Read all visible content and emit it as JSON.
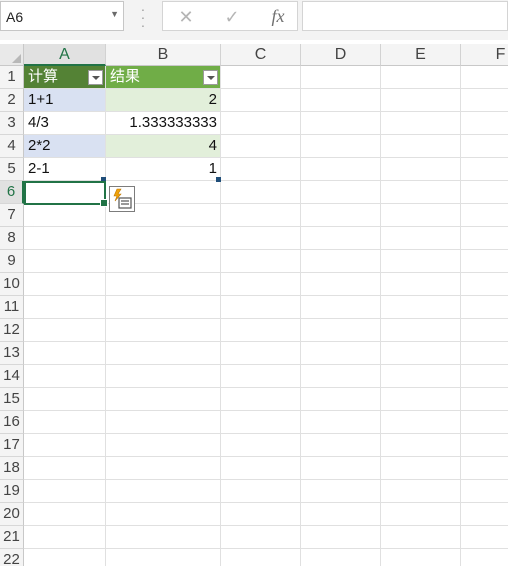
{
  "formula_bar": {
    "name_box": "A6",
    "cancel_icon": "✕",
    "enter_icon": "✓",
    "fx_label": "fx",
    "formula_value": ""
  },
  "columns": [
    "A",
    "B",
    "C",
    "D",
    "E",
    "F"
  ],
  "rows": [
    "1",
    "2",
    "3",
    "4",
    "5",
    "6",
    "7",
    "8",
    "9",
    "10",
    "11",
    "12",
    "13",
    "14",
    "15",
    "16",
    "17",
    "18",
    "19",
    "20",
    "21",
    "22"
  ],
  "table": {
    "headers": [
      "计算",
      "结果"
    ],
    "rows": [
      [
        "1+1",
        "2"
      ],
      [
        "4/3",
        "1.333333333"
      ],
      [
        "2*2",
        "4"
      ],
      [
        "2-1",
        "1"
      ]
    ]
  },
  "selection": {
    "active_cell": "A6"
  },
  "colors": {
    "header_dark": "#548235",
    "header_light": "#70ad47",
    "band_blue": "#d9e1f2",
    "band_green": "#e2efda",
    "selection": "#217346"
  }
}
